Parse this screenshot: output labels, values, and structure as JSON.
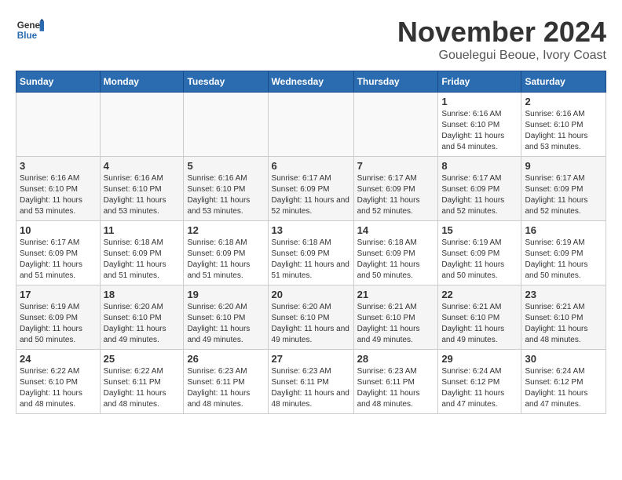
{
  "logo": {
    "general": "General",
    "blue": "Blue"
  },
  "title": "November 2024",
  "location": "Gouelegui Beoue, Ivory Coast",
  "headers": [
    "Sunday",
    "Monday",
    "Tuesday",
    "Wednesday",
    "Thursday",
    "Friday",
    "Saturday"
  ],
  "weeks": [
    [
      {
        "day": "",
        "info": ""
      },
      {
        "day": "",
        "info": ""
      },
      {
        "day": "",
        "info": ""
      },
      {
        "day": "",
        "info": ""
      },
      {
        "day": "",
        "info": ""
      },
      {
        "day": "1",
        "info": "Sunrise: 6:16 AM\nSunset: 6:10 PM\nDaylight: 11 hours and 54 minutes."
      },
      {
        "day": "2",
        "info": "Sunrise: 6:16 AM\nSunset: 6:10 PM\nDaylight: 11 hours and 53 minutes."
      }
    ],
    [
      {
        "day": "3",
        "info": "Sunrise: 6:16 AM\nSunset: 6:10 PM\nDaylight: 11 hours and 53 minutes."
      },
      {
        "day": "4",
        "info": "Sunrise: 6:16 AM\nSunset: 6:10 PM\nDaylight: 11 hours and 53 minutes."
      },
      {
        "day": "5",
        "info": "Sunrise: 6:16 AM\nSunset: 6:10 PM\nDaylight: 11 hours and 53 minutes."
      },
      {
        "day": "6",
        "info": "Sunrise: 6:17 AM\nSunset: 6:09 PM\nDaylight: 11 hours and 52 minutes."
      },
      {
        "day": "7",
        "info": "Sunrise: 6:17 AM\nSunset: 6:09 PM\nDaylight: 11 hours and 52 minutes."
      },
      {
        "day": "8",
        "info": "Sunrise: 6:17 AM\nSunset: 6:09 PM\nDaylight: 11 hours and 52 minutes."
      },
      {
        "day": "9",
        "info": "Sunrise: 6:17 AM\nSunset: 6:09 PM\nDaylight: 11 hours and 52 minutes."
      }
    ],
    [
      {
        "day": "10",
        "info": "Sunrise: 6:17 AM\nSunset: 6:09 PM\nDaylight: 11 hours and 51 minutes."
      },
      {
        "day": "11",
        "info": "Sunrise: 6:18 AM\nSunset: 6:09 PM\nDaylight: 11 hours and 51 minutes."
      },
      {
        "day": "12",
        "info": "Sunrise: 6:18 AM\nSunset: 6:09 PM\nDaylight: 11 hours and 51 minutes."
      },
      {
        "day": "13",
        "info": "Sunrise: 6:18 AM\nSunset: 6:09 PM\nDaylight: 11 hours and 51 minutes."
      },
      {
        "day": "14",
        "info": "Sunrise: 6:18 AM\nSunset: 6:09 PM\nDaylight: 11 hours and 50 minutes."
      },
      {
        "day": "15",
        "info": "Sunrise: 6:19 AM\nSunset: 6:09 PM\nDaylight: 11 hours and 50 minutes."
      },
      {
        "day": "16",
        "info": "Sunrise: 6:19 AM\nSunset: 6:09 PM\nDaylight: 11 hours and 50 minutes."
      }
    ],
    [
      {
        "day": "17",
        "info": "Sunrise: 6:19 AM\nSunset: 6:09 PM\nDaylight: 11 hours and 50 minutes."
      },
      {
        "day": "18",
        "info": "Sunrise: 6:20 AM\nSunset: 6:10 PM\nDaylight: 11 hours and 49 minutes."
      },
      {
        "day": "19",
        "info": "Sunrise: 6:20 AM\nSunset: 6:10 PM\nDaylight: 11 hours and 49 minutes."
      },
      {
        "day": "20",
        "info": "Sunrise: 6:20 AM\nSunset: 6:10 PM\nDaylight: 11 hours and 49 minutes."
      },
      {
        "day": "21",
        "info": "Sunrise: 6:21 AM\nSunset: 6:10 PM\nDaylight: 11 hours and 49 minutes."
      },
      {
        "day": "22",
        "info": "Sunrise: 6:21 AM\nSunset: 6:10 PM\nDaylight: 11 hours and 49 minutes."
      },
      {
        "day": "23",
        "info": "Sunrise: 6:21 AM\nSunset: 6:10 PM\nDaylight: 11 hours and 48 minutes."
      }
    ],
    [
      {
        "day": "24",
        "info": "Sunrise: 6:22 AM\nSunset: 6:10 PM\nDaylight: 11 hours and 48 minutes."
      },
      {
        "day": "25",
        "info": "Sunrise: 6:22 AM\nSunset: 6:11 PM\nDaylight: 11 hours and 48 minutes."
      },
      {
        "day": "26",
        "info": "Sunrise: 6:23 AM\nSunset: 6:11 PM\nDaylight: 11 hours and 48 minutes."
      },
      {
        "day": "27",
        "info": "Sunrise: 6:23 AM\nSunset: 6:11 PM\nDaylight: 11 hours and 48 minutes."
      },
      {
        "day": "28",
        "info": "Sunrise: 6:23 AM\nSunset: 6:11 PM\nDaylight: 11 hours and 48 minutes."
      },
      {
        "day": "29",
        "info": "Sunrise: 6:24 AM\nSunset: 6:12 PM\nDaylight: 11 hours and 47 minutes."
      },
      {
        "day": "30",
        "info": "Sunrise: 6:24 AM\nSunset: 6:12 PM\nDaylight: 11 hours and 47 minutes."
      }
    ]
  ]
}
